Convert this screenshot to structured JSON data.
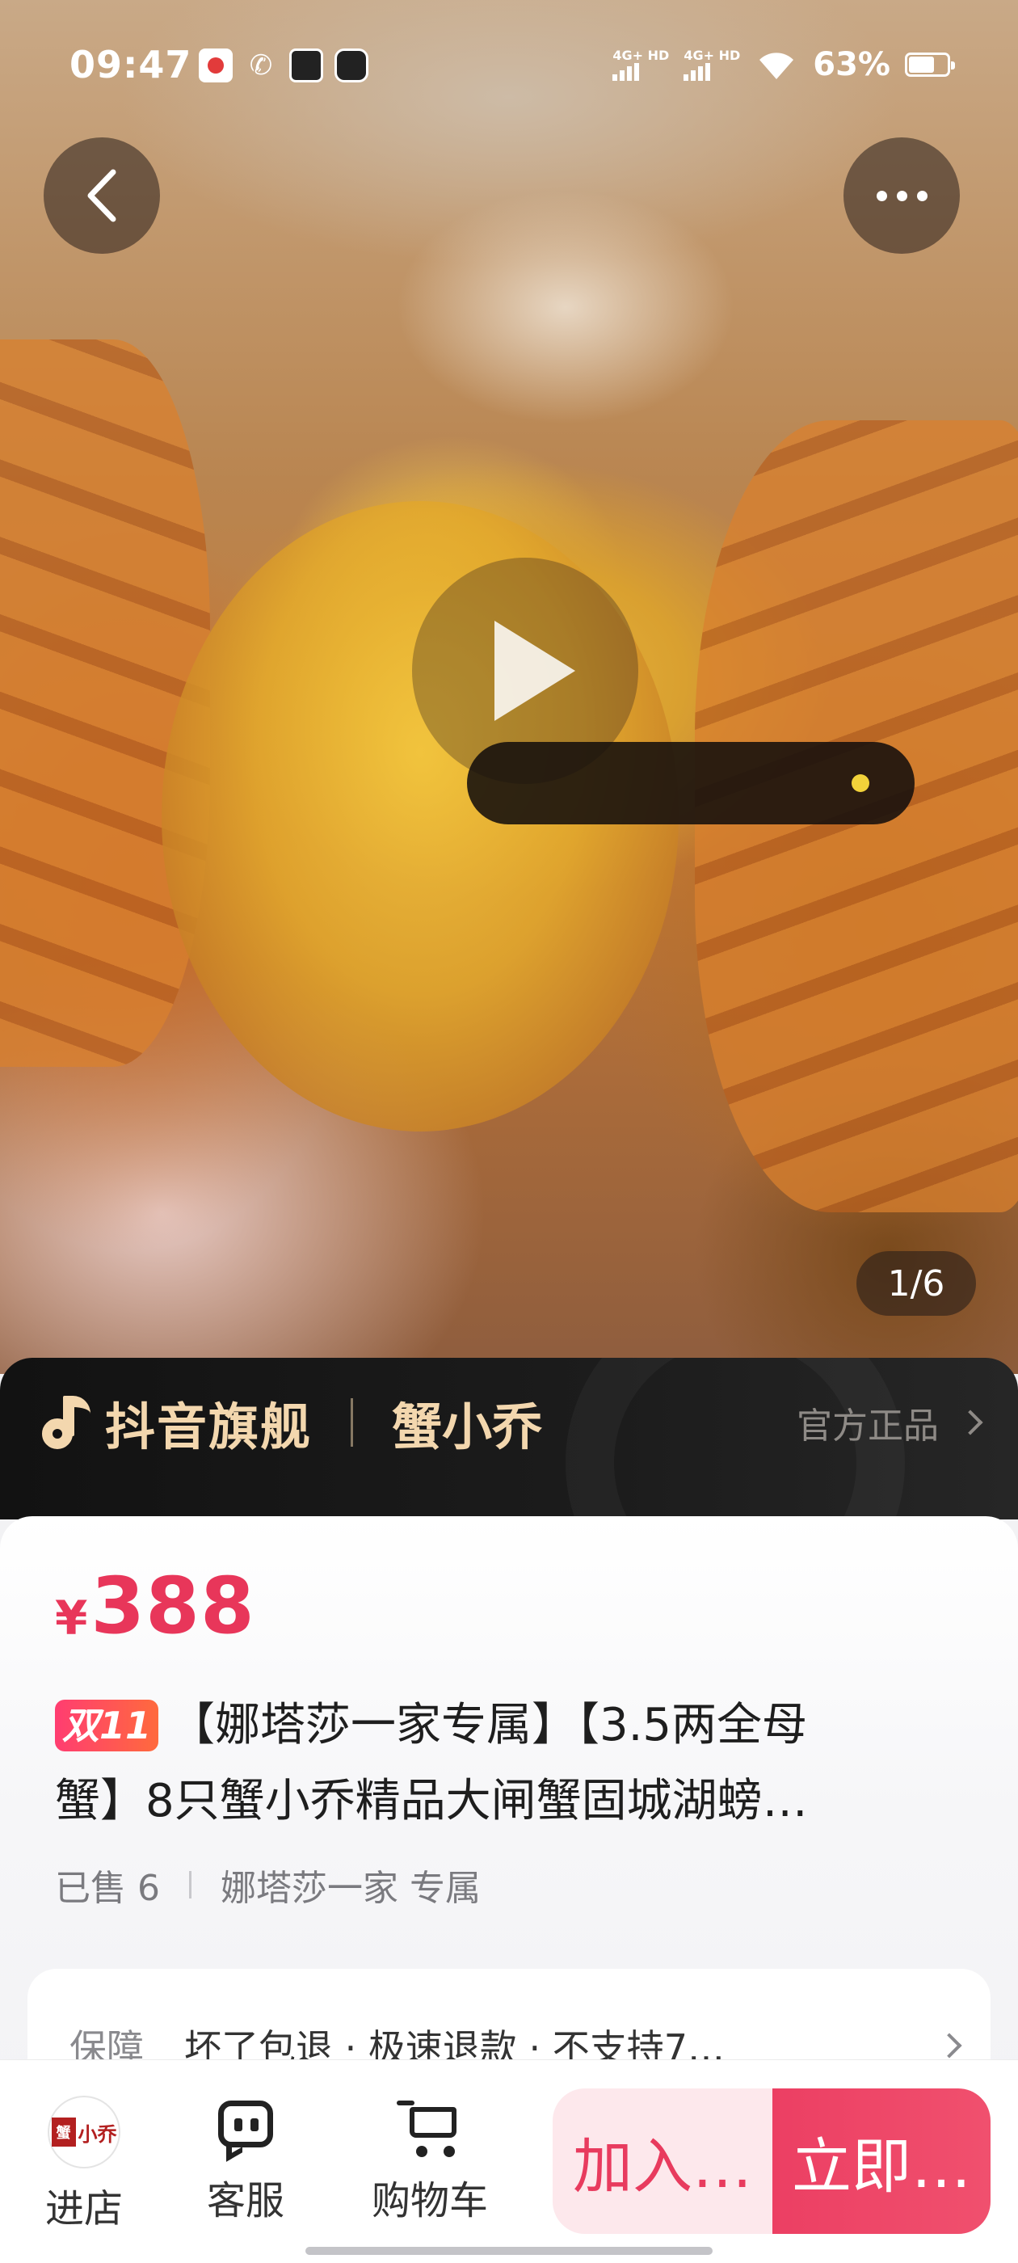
{
  "status_bar": {
    "time": "09:47",
    "network_1": "4G+ HD",
    "network_2": "4G+ HD",
    "battery": "63%"
  },
  "gallery": {
    "page_indicator": "1/6",
    "current_page": 1,
    "total_pages": 6
  },
  "brand": {
    "platform": "抖音旗舰",
    "shop_name": "蟹小乔",
    "official_label": "官方正品"
  },
  "product": {
    "price_symbol": "¥",
    "price": "388",
    "promo_badge": "双11",
    "title_line_1": "【娜塔莎一家专属】【3.5两全母",
    "title_line_2": "蟹】8只蟹小乔精品大闸蟹固城湖螃…",
    "sold": "已售 6",
    "exclusive": "娜塔莎一家 专属"
  },
  "guarantee": {
    "label": "保障",
    "text": "坏了包退 · 极速退款 · 不支持7…"
  },
  "bottom_bar": {
    "store_label": "进店",
    "store_logo_text": "小乔",
    "service_label": "客服",
    "cart_label": "购物车",
    "add_to_cart": "加入…",
    "buy_now": "立即…"
  },
  "colors": {
    "price_red": "#e8365a",
    "brand_gold": "#f3d7ae",
    "buy_button": "#ec3f63",
    "add_cart_bg": "#fde8ec"
  }
}
